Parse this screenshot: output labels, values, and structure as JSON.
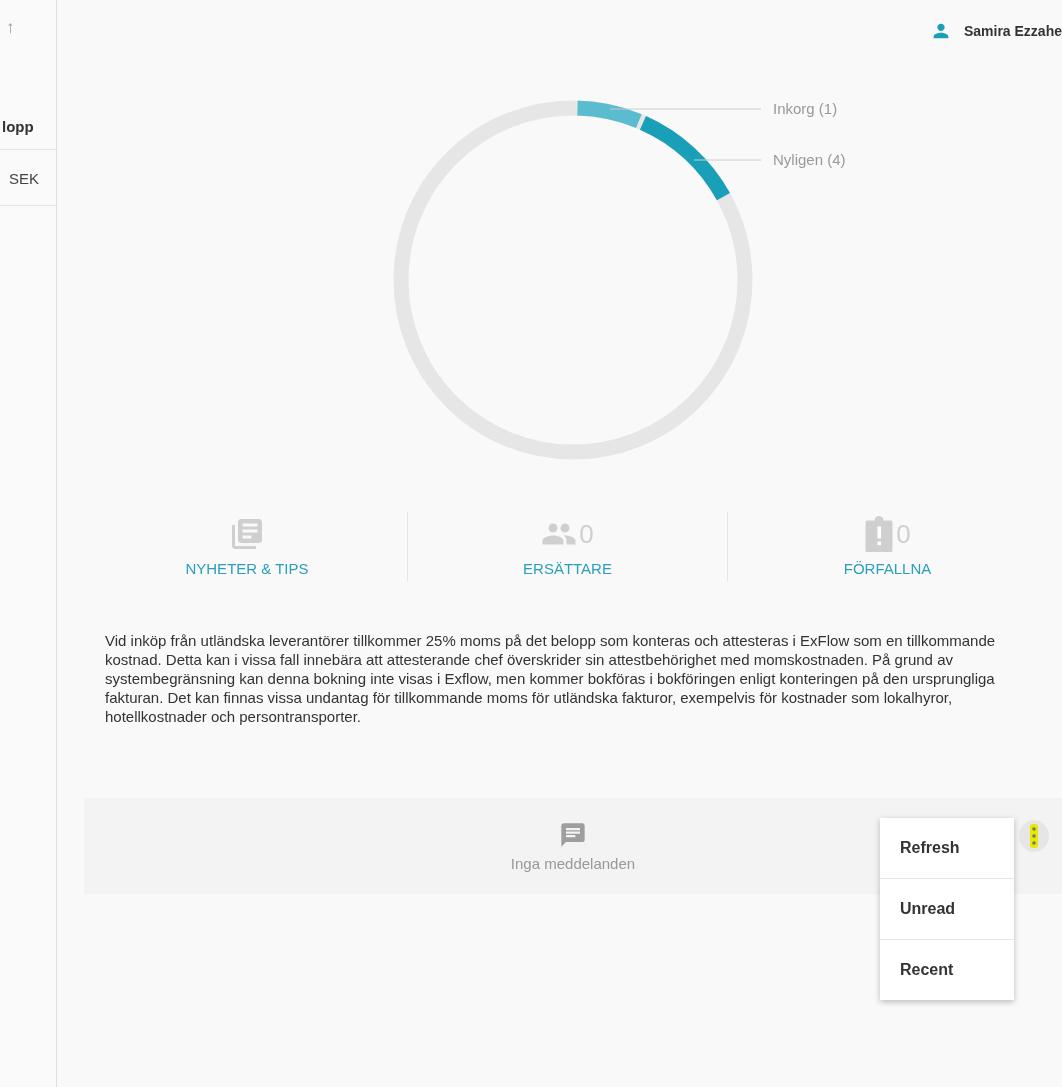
{
  "side_table": {
    "sort_arrow": "↑",
    "header": "lopp",
    "cells": [
      "SEK"
    ]
  },
  "user": {
    "name": "Samira Ezzahe"
  },
  "overview": {
    "segments": [
      {
        "label": "Inkorg (1)",
        "color": "#5bbccf"
      },
      {
        "label": "Nyligen (4)",
        "color": "#1a9fb8"
      }
    ]
  },
  "stats": [
    {
      "kind": "news",
      "label": "NYHETER & TIPS"
    },
    {
      "kind": "substitutes",
      "count": "0",
      "label": "ERSÄTTARE"
    },
    {
      "kind": "overdue",
      "count": "0",
      "label": "FÖRFALLNA"
    }
  ],
  "notice": "Vid inköp från utländska leverantörer tillkommer 25% moms på det belopp som konteras och attesteras i ExFlow som en tillkommande kostnad. Detta kan i vissa fall innebära att attesterande chef överskrider sin attestbehörighet med momskostnaden. På grund av systembegränsning kan denna bokning inte visas i Exflow, men kommer bokföras i bokföringen enligt konteringen på den ursprungliga fakturan. Det kan finnas vissa undantag för tillkommande moms för utländska fakturor, exempelvis för kostnader som lokalhyror, hotellkostnader och persontransporter.",
  "messages": {
    "empty_text": "Inga meddelanden"
  },
  "menu": {
    "items": [
      "Refresh",
      "Unread",
      "Recent"
    ]
  }
}
